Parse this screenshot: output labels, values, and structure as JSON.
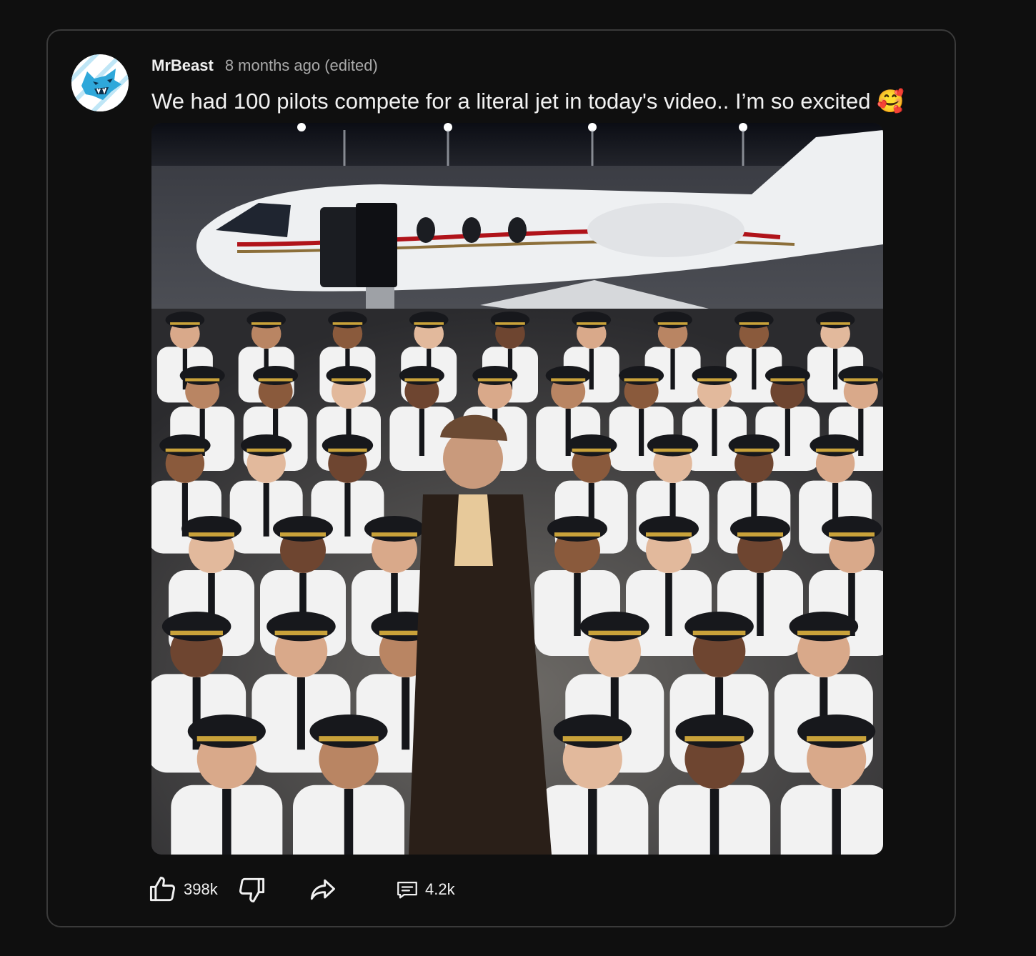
{
  "post": {
    "author": "MrBeast",
    "timestamp": "8 months ago (edited)",
    "text": "We had 100 pilots compete for a literal jet in today's video.. I’m so excited 🥰",
    "image_alt": "We had 100 pilots compete for a literal jet in today's video",
    "avatar_icon": "beast-panther-logo-icon"
  },
  "actions": {
    "like_count": "398k",
    "comment_count": "4.2k",
    "like_icon": "thumbs-up-icon",
    "dislike_icon": "thumbs-down-icon",
    "share_icon": "share-arrow-icon",
    "comment_icon": "comment-icon"
  },
  "colors": {
    "background": "#0f0f0f",
    "card_border": "#3a3a3a",
    "text_primary": "#f1f1f1",
    "text_secondary": "#aaaaaa",
    "avatar_accent": "#39b4e6"
  }
}
